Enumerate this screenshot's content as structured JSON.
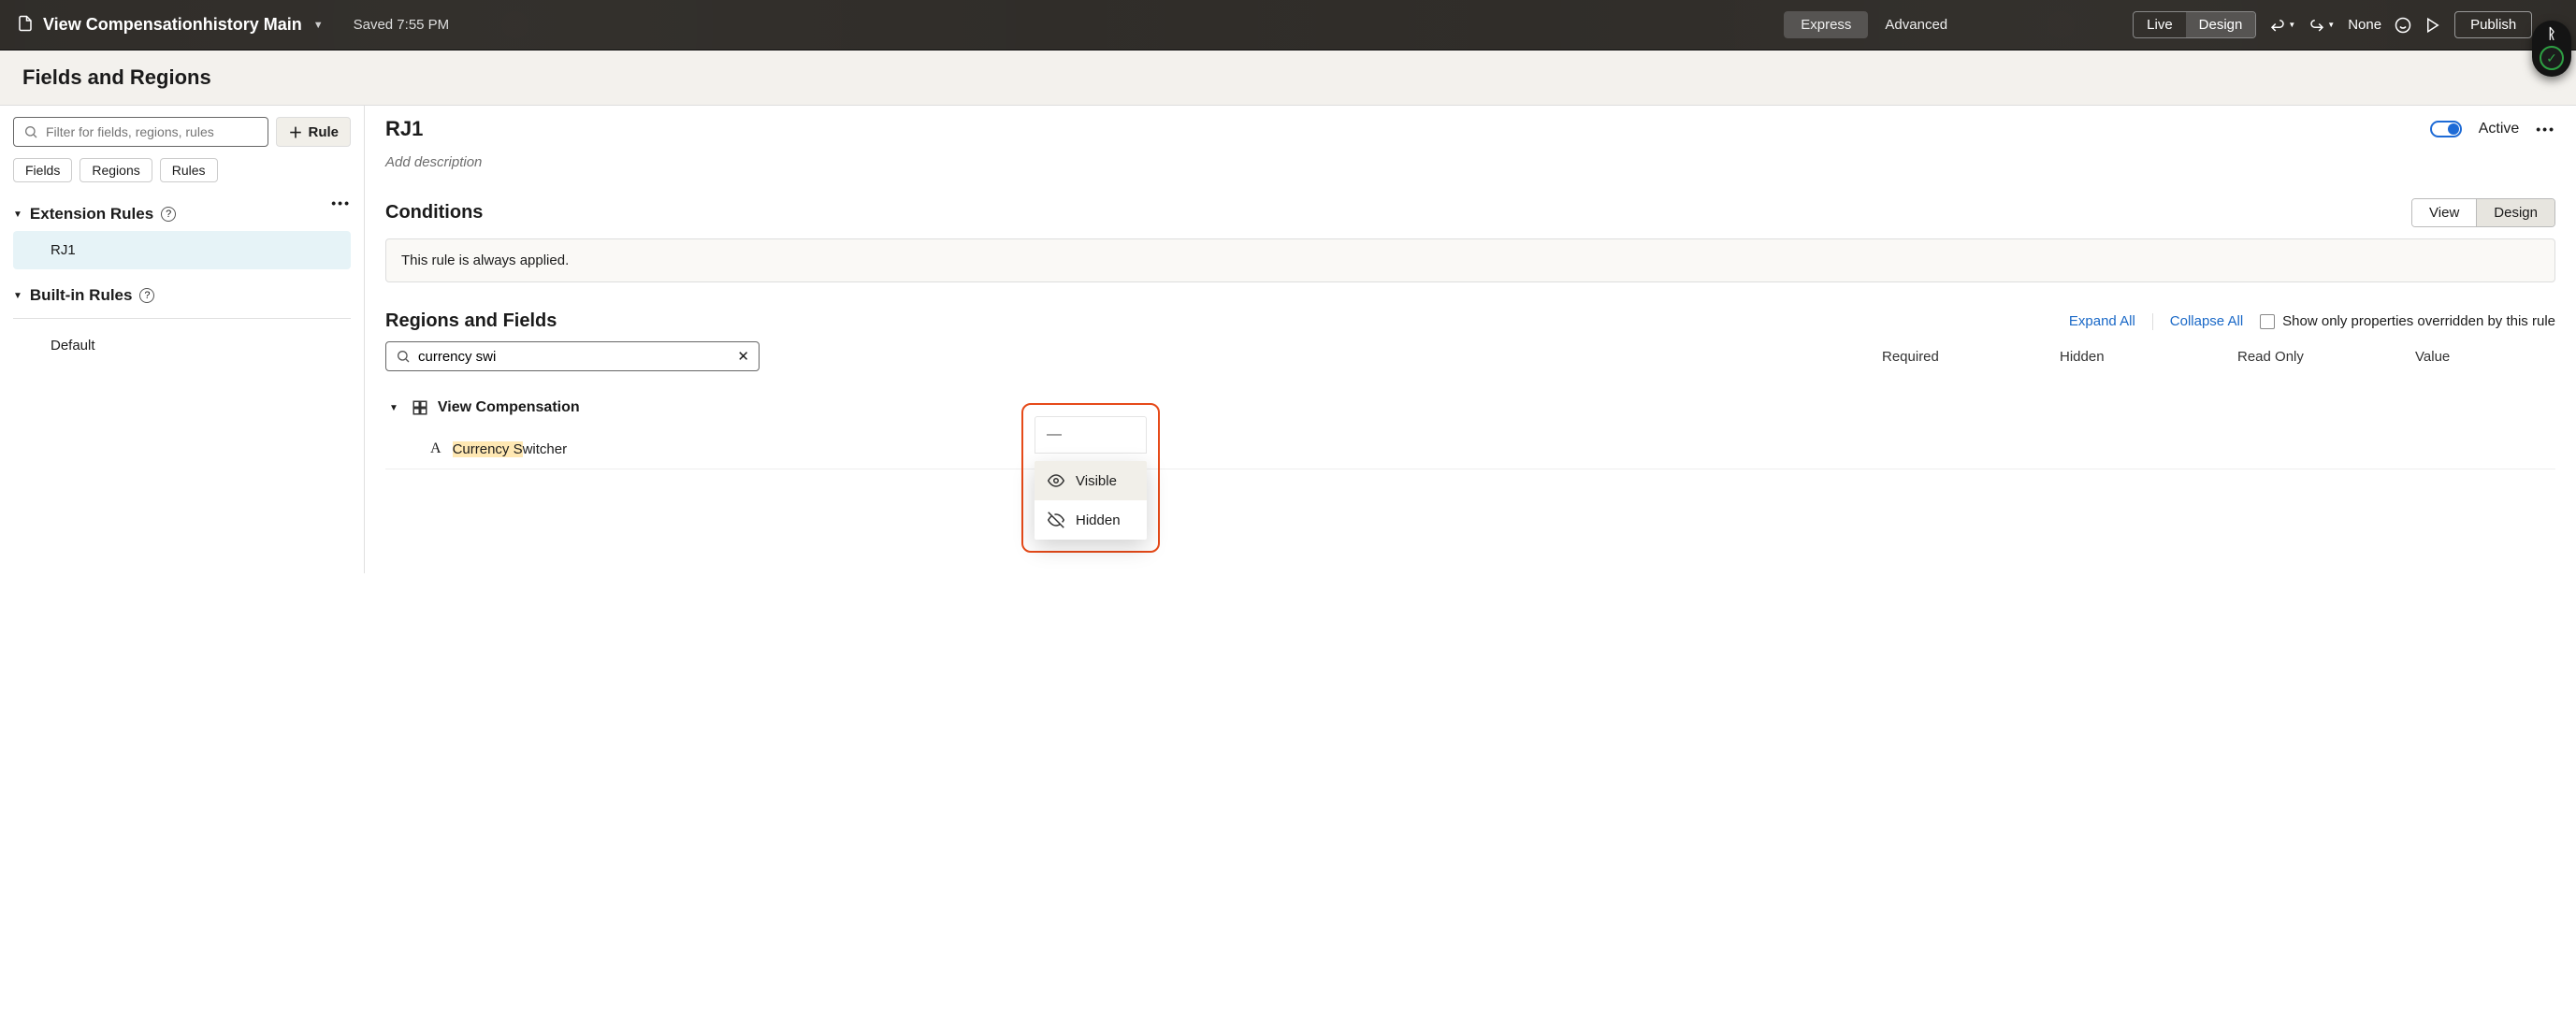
{
  "topbar": {
    "title": "View Compensationhistory Main",
    "saved": "Saved 7:55 PM",
    "mode": {
      "express": "Express",
      "advanced": "Advanced"
    },
    "live": "Live",
    "design": "Design",
    "none": "None",
    "publish": "Publish"
  },
  "subheader": "Fields and Regions",
  "left": {
    "filter_placeholder": "Filter for fields, regions, rules",
    "rule_btn": "Rule",
    "chips": {
      "fields": "Fields",
      "regions": "Regions",
      "rules": "Rules"
    },
    "ext_rules": "Extension Rules",
    "rule_rj1": "RJ1",
    "builtin_rules": "Built-in Rules",
    "rule_default": "Default"
  },
  "right": {
    "title": "RJ1",
    "active": "Active",
    "add_desc": "Add description",
    "conditions": "Conditions",
    "view": "View",
    "design": "Design",
    "cond_text": "This rule is always applied.",
    "regions_fields": "Regions and Fields",
    "expand": "Expand All",
    "collapse": "Collapse All",
    "show_overridden": "Show only properties overridden by this rule",
    "search_value": "currency swi",
    "col_required": "Required",
    "col_hidden": "Hidden",
    "col_readonly": "Read Only",
    "col_value": "Value",
    "node_view_comp": "View Compensation",
    "leaf_currency_a": "Currency S",
    "leaf_currency_b": "wi",
    "leaf_currency_c": "tcher",
    "hidden_current": "—",
    "menu_visible": "Visible",
    "menu_hidden": "Hidden"
  }
}
